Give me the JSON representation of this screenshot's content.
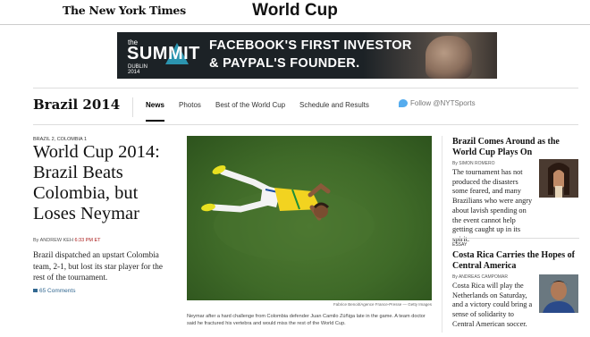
{
  "masthead": {
    "logo": "The New York Times",
    "section": "World Cup"
  },
  "ad": {
    "brand_small": "the",
    "brand": "SUMMIT",
    "location": "DUBLIN",
    "year": "2014",
    "line1": "FACEBOOK'S FIRST INVESTOR",
    "line2": "& PAYPAL'S FOUNDER."
  },
  "subnav": {
    "brand": "Brazil 2014",
    "items": [
      "News",
      "Photos",
      "Best of the World Cup",
      "Schedule and Results"
    ],
    "active": "News",
    "twitter": "Follow @NYTSports"
  },
  "lead": {
    "kicker": "BRAZIL 2, COLOMBIA 1",
    "headline": "World Cup 2014: Brazil Beats Colombia, but Loses Neymar",
    "byline_author": "By ANDREW KEH",
    "byline_time": "6:33 PM ET",
    "summary": "Brazil dispatched an upstart Colombia team, 2-1, but lost its star player for the rest of the tournament.",
    "comments": "65 Comments"
  },
  "photo": {
    "credit": "Fabrice Benoit/Agence France-Presse — Getty Images",
    "caption": "Neymar after a hard challenge from Colombia defender Juan Camilo Zúñiga late in the game. A team doctor said he fractured his vertebra and would miss the rest of the World Cup."
  },
  "right": {
    "story1": {
      "headline": "Brazil Comes Around as the World Cup Plays On",
      "byline": "By SIMON ROMERO",
      "text": "The tournament has not produced the disasters some feared, and many Brazilians who were angry about lavish spending on the event cannot help getting caught up in its spirit."
    },
    "story2": {
      "label": "ESSAY",
      "headline": "Costa Rica Carries the Hopes of Central America",
      "byline": "By ANDREAS CAMPOMAR",
      "text": "Costa Rica will play the Netherlands on Saturday, and a victory could bring a sense of solidarity to Central American soccer."
    }
  },
  "colors": {
    "link": "#326891",
    "timestamp": "#a81817",
    "twitter": "#55acee",
    "pitch": "#3f6a28"
  }
}
